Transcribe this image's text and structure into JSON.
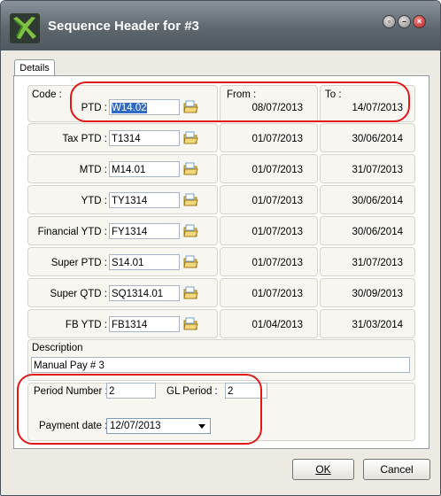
{
  "window": {
    "title": "Sequence Header for #3",
    "icons": [
      "app-logo-icon",
      "restore-icon",
      "minimize-icon",
      "close-icon"
    ]
  },
  "tabs": [
    {
      "label": "Details"
    }
  ],
  "headers": {
    "code": "Code :",
    "from": "From :",
    "to": "To :"
  },
  "rows": [
    {
      "label": "PTD :",
      "code": "W14.02",
      "from": "08/07/2013",
      "to": "14/07/2013"
    },
    {
      "label": "Tax PTD :",
      "code": "T1314",
      "from": "01/07/2013",
      "to": "30/06/2014"
    },
    {
      "label": "MTD :",
      "code": "M14.01",
      "from": "01/07/2013",
      "to": "31/07/2013"
    },
    {
      "label": "YTD :",
      "code": "TY1314",
      "from": "01/07/2013",
      "to": "30/06/2014"
    },
    {
      "label": "Financial YTD :",
      "code": "FY1314",
      "from": "01/07/2013",
      "to": "30/06/2014"
    },
    {
      "label": "Super PTD :",
      "code": "S14.01",
      "from": "01/07/2013",
      "to": "31/07/2013"
    },
    {
      "label": "Super QTD :",
      "code": "SQ1314.01",
      "from": "01/07/2013",
      "to": "30/09/2013"
    },
    {
      "label": "FB YTD :",
      "code": "FB1314",
      "from": "01/04/2013",
      "to": "31/03/2014"
    }
  ],
  "description": {
    "label": "Description",
    "value": "Manual Pay # 3"
  },
  "period": {
    "label": "Period Number :",
    "value": "2"
  },
  "gl_period": {
    "label": "GL Period :",
    "value": "2"
  },
  "payment_date": {
    "label": "Payment date :",
    "value": "12/07/2013"
  },
  "buttons": {
    "ok_label": "OK",
    "cancel_label": "Cancel"
  },
  "colors": {
    "highlight_oval": "#e01818",
    "selection": "#316ac5",
    "titlebar": "#5e666e"
  }
}
